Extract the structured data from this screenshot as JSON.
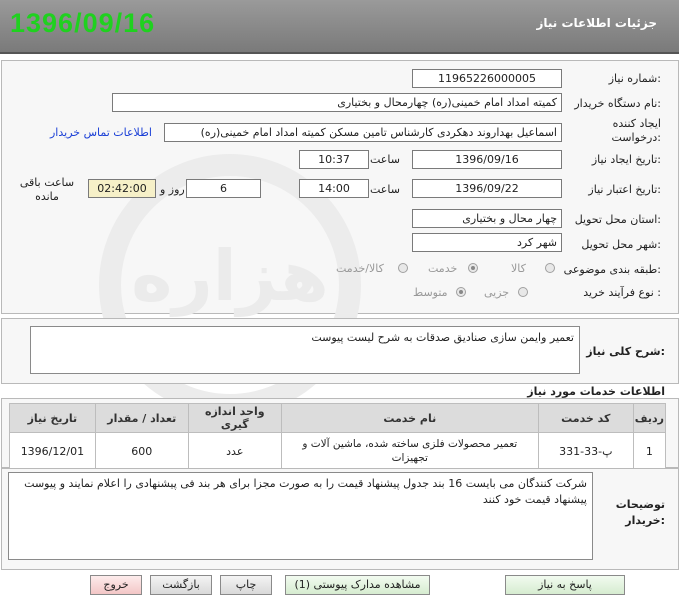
{
  "header": {
    "title": "جزئیات اطلاعات نیاز",
    "date": "1396/09/16"
  },
  "form": {
    "need_number": {
      "label": "شماره نیاز:",
      "value": "1196522600000‌5"
    },
    "buyer_org": {
      "label": "نام دستگاه خریدار:",
      "value": "کمیته امداد امام خمینی(ره) چهارمحال و بختیاری"
    },
    "requester": {
      "label": "ایجاد کننده درخواست:",
      "value": "اسماعیل بهداروند دهکردی کارشناس تامین مسکن کمیته امداد امام خمینی(ره)",
      "contact_link": "اطلاعات تماس خریدار"
    },
    "created": {
      "label": "تاریخ ایجاد نیاز:",
      "date": "1396/09/16",
      "time_label": "ساعت",
      "time": "10:37"
    },
    "validity": {
      "label": "تاریخ اعتبار نیاز:",
      "date": "1396/09/22",
      "time_label": "ساعت",
      "time": "14:00",
      "days": "6",
      "days_label": "روز و",
      "remaining": "02:42:00",
      "remaining_label": "ساعت باقی مانده"
    },
    "province": {
      "label": "استان محل تحویل:",
      "value": "چهار محال و بختیاری"
    },
    "city": {
      "label": "شهر محل تحویل:",
      "value": "شهر کرد"
    },
    "category": {
      "label": "طبقه بندی موضوعی:",
      "options": [
        "کالا",
        "خدمت",
        "کالا/خدمت"
      ],
      "selected": "خدمت"
    },
    "process": {
      "label": "نوع فرآیند خرید :",
      "options": [
        "جزیی",
        "متوسط"
      ],
      "selected": "متوسط"
    }
  },
  "description": {
    "label": "شرح کلی نیاز:",
    "value": "تعمیر وایمن سازی صنادیق صدقات به شرح لیست پیوست"
  },
  "services": {
    "title": "اطلاعات خدمات مورد نیاز",
    "columns": [
      "ردیف",
      "کد خدمت",
      "نام خدمت",
      "واحد اندازه گیری",
      "تعداد / مقدار",
      "تاریخ نیاز"
    ],
    "rows": [
      {
        "row": "1",
        "code": "پ-33-331",
        "name": "تعمیر محصولات فلزی ساخته شده، ماشین آلات و تجهیزات",
        "unit": "عدد",
        "qty": "600",
        "date": "1396/12/01"
      }
    ]
  },
  "buyer_notes": {
    "label": "توضیحات خریدار:",
    "value": "شرکت کنندگان می بایست 16 بند جدول پیشنهاد قیمت را به صورت مجزا برای هر بند فی پیشنهادی را اعلام نمایند و پیوست پیشنهاد قیمت خود کنند"
  },
  "buttons": {
    "reply": "پاسخ به نیاز",
    "attachments": "مشاهده مدارک پیوستی (1)",
    "print": "چاپ",
    "back": "بازگشت",
    "exit": "خروج"
  },
  "watermark": {
    "text": "هزاره"
  }
}
